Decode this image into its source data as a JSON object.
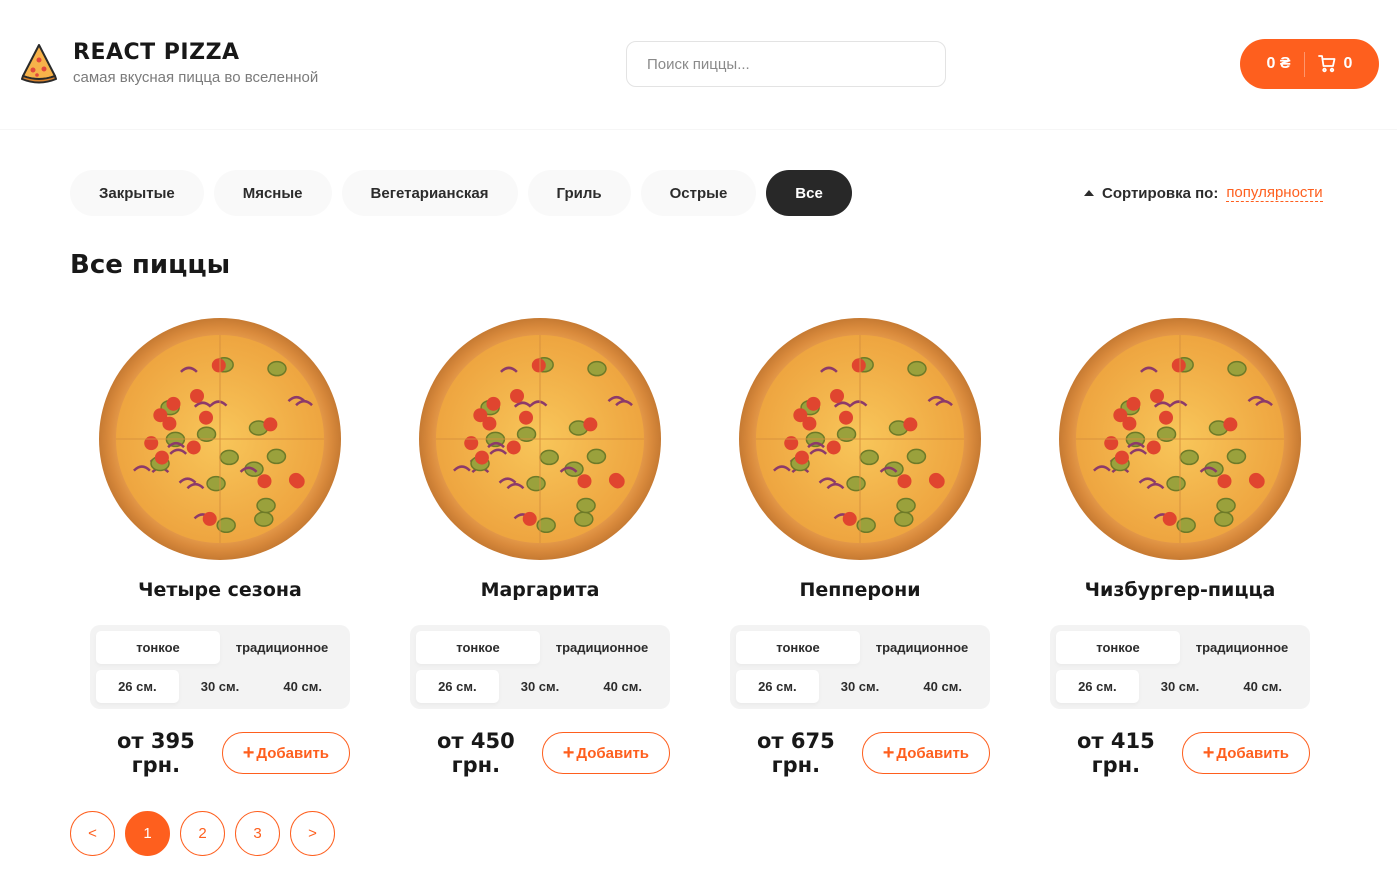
{
  "header": {
    "logo_title": "REACT PIZZA",
    "logo_subtitle": "самая вкусная пицца во вселенной",
    "search_placeholder": "Поиск пиццы...",
    "cart_price": "0 ₴",
    "cart_count": "0"
  },
  "categories": [
    "Закрытые",
    "Мясные",
    "Вегетарианская",
    "Гриль",
    "Острые",
    "Все"
  ],
  "active_category": "Все",
  "sort": {
    "label": "Сортировка по:",
    "value": "популярности"
  },
  "content_title": "Все пиццы",
  "pizzas": [
    {
      "title": "Четыре сезона",
      "types": [
        "тонкое",
        "традиционное"
      ],
      "sizes": [
        "26 см.",
        "30 см.",
        "40 см."
      ],
      "price": "от 395 грн.",
      "add_label": "Добавить"
    },
    {
      "title": "Маргарита",
      "types": [
        "тонкое",
        "традиционное"
      ],
      "sizes": [
        "26 см.",
        "30 см.",
        "40 см."
      ],
      "price": "от 450 грн.",
      "add_label": "Добавить"
    },
    {
      "title": "Пепперони",
      "types": [
        "тонкое",
        "традиционное"
      ],
      "sizes": [
        "26 см.",
        "30 см.",
        "40 см."
      ],
      "price": "от 675 грн.",
      "add_label": "Добавить"
    },
    {
      "title": "Чизбургер-пицца",
      "types": [
        "тонкое",
        "традиционное"
      ],
      "sizes": [
        "26 см.",
        "30 см.",
        "40 см."
      ],
      "price": "от 415 грн.",
      "add_label": "Добавить"
    }
  ],
  "pagination": {
    "prev": "<",
    "pages": [
      "1",
      "2",
      "3"
    ],
    "next": ">",
    "current": "1"
  },
  "colors": {
    "accent": "#fe5f1e",
    "dark": "#282828",
    "chip_bg": "#f9f9f9"
  }
}
